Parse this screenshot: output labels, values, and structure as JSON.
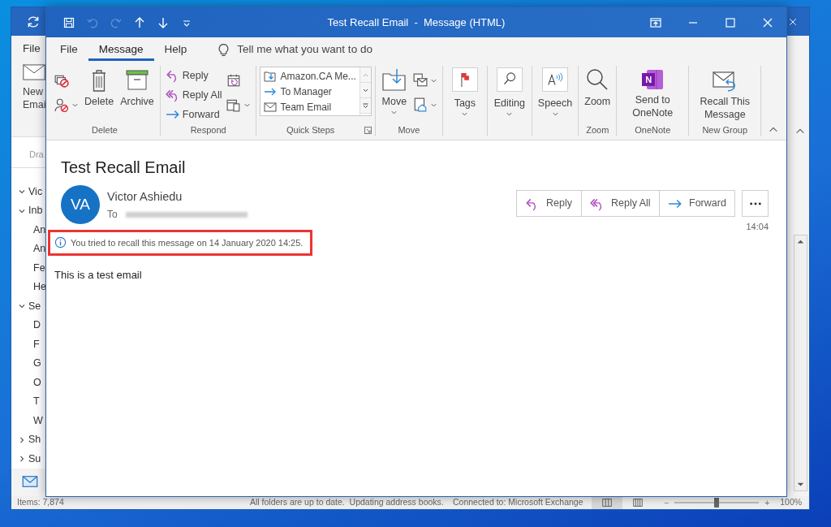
{
  "back_window": {
    "menu_tab": "File",
    "new_email_lines": [
      "New",
      "Emai"
    ],
    "folder_header": "Dra",
    "folders": [
      {
        "label": "Vic",
        "expanded": true
      },
      {
        "label": "Inb",
        "expanded": true,
        "children": [
          {
            "label": "An"
          },
          {
            "label": "An"
          },
          {
            "label": "Fe"
          },
          {
            "label": "He"
          }
        ]
      },
      {
        "label": "Se",
        "expanded": true,
        "children": [
          {
            "label": "D"
          },
          {
            "label": "F"
          },
          {
            "label": "G"
          },
          {
            "label": "O"
          },
          {
            "label": "T"
          },
          {
            "label": "W"
          }
        ]
      },
      {
        "label": "Sh",
        "expanded": false
      },
      {
        "label": "Su",
        "expanded": false
      }
    ],
    "status_bar": {
      "items": "Items: 7,874",
      "sync": "All folders are up to date.  Updating address books.",
      "connection": "Connected to: Microsoft Exchange",
      "views": [
        {
          "kind": "normal",
          "selected": true
        },
        {
          "kind": "reading",
          "selected": false
        }
      ],
      "zoom_out": "−",
      "zoom": {
        "level": 0.5
      },
      "zoom_in": "+",
      "zoom_percent": "100%"
    }
  },
  "message_window": {
    "title": "Test Recall Email  -  Message (HTML)",
    "quick_access": [
      {
        "kind": "save",
        "disabled": false
      },
      {
        "kind": "undo",
        "disabled": true
      },
      {
        "kind": "redo",
        "disabled": true
      },
      {
        "kind": "up",
        "disabled": false
      },
      {
        "kind": "down",
        "disabled": false
      },
      {
        "kind": "customize",
        "disabled": false
      }
    ],
    "tabs": [
      {
        "label": "File",
        "selected": false
      },
      {
        "label": "Message",
        "selected": true
      },
      {
        "label": "Help",
        "selected": false
      }
    ],
    "tell_me": "Tell me what you want to do",
    "ribbon": [
      {
        "label": "Delete",
        "items": [
          {
            "kind": "stack",
            "buttons": [
              {
                "kind": "ignore",
                "caret": false
              },
              {
                "kind": "cleanup",
                "caret": true
              }
            ]
          },
          {
            "kind": "trash",
            "label": "Delete"
          },
          {
            "kind": "archive",
            "label": "Archive"
          }
        ]
      },
      {
        "label": "Respond",
        "items": [
          {
            "kind": "stack",
            "buttons": [
              {
                "kind": "reply",
                "label": "Reply"
              },
              {
                "kind": "reply_all",
                "label": "Reply All"
              },
              {
                "kind": "forward",
                "label": "Forward"
              }
            ]
          },
          {
            "kind": "stack",
            "buttons": [
              {
                "kind": "meeting",
                "caret": false
              },
              {
                "kind": "more",
                "caret": true
              }
            ]
          }
        ]
      },
      {
        "label": "Quick Steps",
        "launcher": true,
        "items": [
          {
            "kind": "gallery",
            "entries": [
              {
                "kind": "move_to",
                "label": "Amazon.CA Me..."
              },
              {
                "kind": "forward",
                "label": "To Manager"
              },
              {
                "kind": "mail",
                "label": "Team Email"
              }
            ]
          }
        ]
      },
      {
        "label": "Move",
        "items": [
          {
            "kind": "move",
            "label": "Move",
            "caret": true
          },
          {
            "kind": "stack",
            "buttons": [
              {
                "kind": "rules",
                "caret": true
              },
              {
                "kind": "actions",
                "caret": true
              }
            ]
          }
        ]
      },
      {
        "items": [
          {
            "kind": "flag",
            "label": "Tags",
            "caret": true
          }
        ]
      },
      {
        "items": [
          {
            "kind": "find",
            "label": "Editing",
            "caret": true
          }
        ]
      },
      {
        "items": [
          {
            "kind": "speech",
            "label": "Speech",
            "caret": true
          }
        ]
      },
      {
        "label": "Zoom",
        "items": [
          {
            "kind": "zoom",
            "label": "Zoom"
          }
        ]
      },
      {
        "label": "OneNote",
        "items": [
          {
            "kind": "notebook",
            "logo_letter": "N",
            "label": "Send to OneNote"
          }
        ]
      },
      {
        "label": "New Group",
        "items": [
          {
            "kind": "recall",
            "label": "Recall This Message"
          }
        ]
      }
    ],
    "message": {
      "subject": "Test Recall Email",
      "initials": "VA",
      "sender": "Victor Ashiedu",
      "to_label": "To",
      "actions": [
        {
          "kind": "reply",
          "label": "Reply"
        },
        {
          "kind": "reply_all",
          "label": "Reply All"
        },
        {
          "kind": "forward",
          "label": "Forward"
        }
      ],
      "time": "14:04",
      "info": "You tried to recall this message on 14 January 2020 14:25.",
      "info_highlighted": true,
      "body": "This is a test email"
    }
  }
}
